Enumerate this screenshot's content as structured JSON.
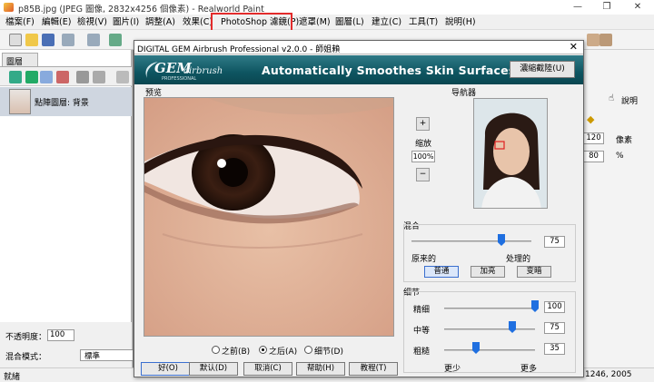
{
  "window": {
    "title": "p85B.jpg (JPEG 圖像, 2832x4256 個像素) - Realworld Paint"
  },
  "menu": [
    "檔案(F)",
    "編輯(E)",
    "檢視(V)",
    "圖片(I)",
    "調整(A)",
    "效果(C)",
    "PhotoShop 濾鏡(P)",
    "遮罩(M)",
    "圖層(L)",
    "建立(C)",
    "工具(T)",
    "說明(H)"
  ],
  "left_panel": {
    "tab": "圖層",
    "layer_name": "點陣圖層: 背景",
    "opacity_label": "不透明度：",
    "opacity_value": "100",
    "blend_label": "混合模式：",
    "blend_value": "標準"
  },
  "right_panel": {
    "help": "說明",
    "val1": "120",
    "unit1": "像素",
    "val2": "80",
    "unit2": "%"
  },
  "statusbar": {
    "left": "就緒",
    "right": "1246, 2005"
  },
  "dialog": {
    "title": "DIGITAL GEM Airbrush Professional v2.0.0 - 師姐賴",
    "logo_gem": "GEM",
    "logo_airbrush": "airbrush",
    "logo_sub": "PROFESSIONAL",
    "tagline": "Automatically Smoothes Skin Surfaces",
    "register_btn": "濃縮截陸(U)",
    "preview_label": "预览",
    "navigator_label": "导航器",
    "zoom_label": "缩放",
    "zoom_plus": "+",
    "zoom_minus": "−",
    "zoom_value": "100%",
    "blend": {
      "label": "混合",
      "value": "75",
      "left": "原来的",
      "right": "处理的",
      "modes": [
        "普通",
        "加亮",
        "变暗"
      ]
    },
    "detail": {
      "label": "细节",
      "rows": [
        {
          "label": "精细",
          "value": "100"
        },
        {
          "label": "中等",
          "value": "75"
        },
        {
          "label": "粗糙",
          "value": "35"
        }
      ],
      "less": "更少",
      "more": "更多"
    },
    "view_options": [
      "之前(B)",
      "之后(A)",
      "细节(D)"
    ],
    "buttons": [
      "好(O)",
      "默认(D)",
      "取消(C)",
      "帮助(H)",
      "教程(T)"
    ]
  }
}
